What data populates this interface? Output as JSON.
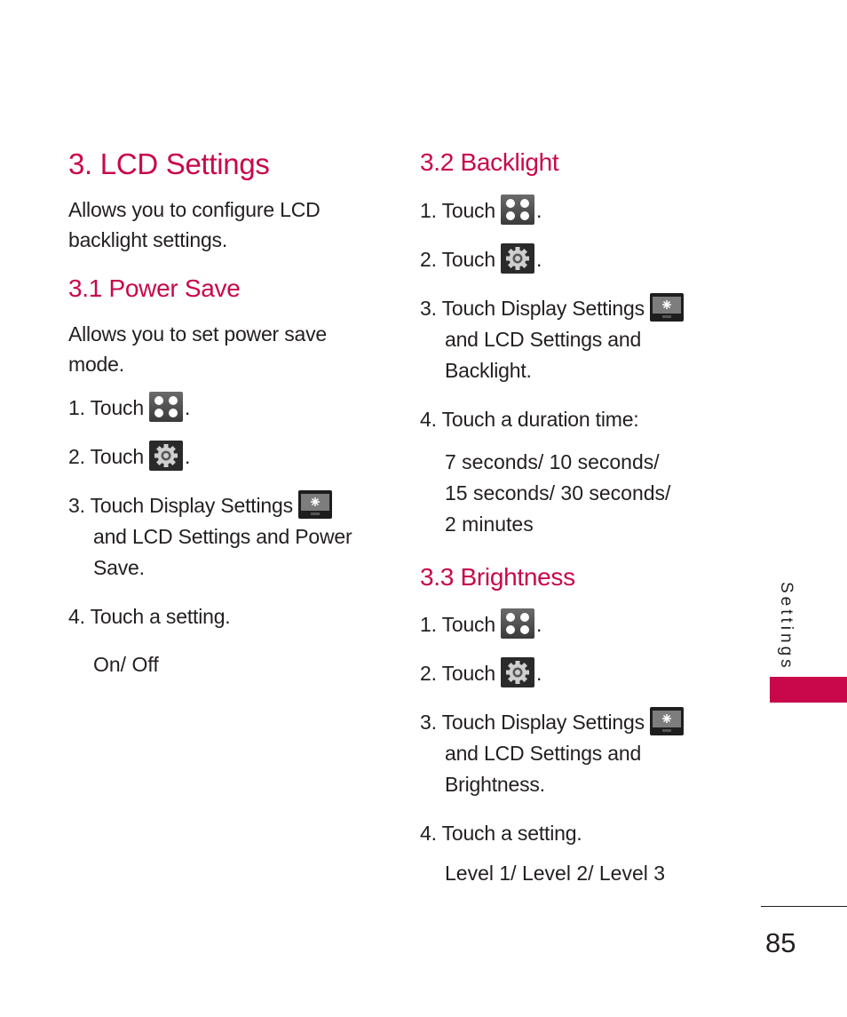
{
  "page": {
    "number": "85",
    "side_tab_label": "Settings",
    "accent_color": "#c8084a"
  },
  "left": {
    "title": "3. LCD Settings",
    "intro_line1": "Allows you to configure LCD",
    "intro_line2": "backlight settings.",
    "power_save": {
      "heading": "3.1 Power Save",
      "desc_line1": "Allows you to set power save",
      "desc_line2": "mode.",
      "step1": {
        "num": "1.",
        "text": "Touch",
        "icon": "menu-grid-icon",
        "end": "."
      },
      "step2": {
        "num": "2.",
        "text": "Touch",
        "icon": "settings-gear-icon",
        "end": "."
      },
      "step3": {
        "num": "3.",
        "text": "Touch",
        "bold1": "Display Settings",
        "icon": "display-settings-icon",
        "and1": "and",
        "bold2": "LCD Settings",
        "and2": "and",
        "bold3a": "Power",
        "bold3b": "Save",
        "end": "."
      },
      "step4": {
        "num": "4.",
        "text": "Touch a setting."
      },
      "options": "On/ Off"
    }
  },
  "right": {
    "backlight": {
      "heading": "3.2 Backlight",
      "step1": {
        "num": "1.",
        "text": "Touch",
        "end": "."
      },
      "step2": {
        "num": "2.",
        "text": "Touch",
        "end": "."
      },
      "step3": {
        "num": "3.",
        "text": "Touch",
        "bold1": "Display Settings",
        "and1": "and",
        "bold2": "LCD Settings",
        "and2": "and",
        "bold3": "Backlight",
        "end": "."
      },
      "step4": {
        "num": "4.",
        "text": "Touch a duration time:"
      },
      "options_line1": "7 seconds/ 10 seconds/",
      "options_line2": "15 seconds/ 30 seconds/",
      "options_line3": "2 minutes"
    },
    "brightness": {
      "heading": "3.3 Brightness",
      "step1": {
        "num": "1.",
        "text": "Touch",
        "end": "."
      },
      "step2": {
        "num": "2.",
        "text": "Touch",
        "end": "."
      },
      "step3": {
        "num": "3.",
        "text": "Touch",
        "bold1": "Display Settings",
        "and1": "and",
        "bold2": "LCD Settings",
        "and2": "and",
        "bold3": "Brightness",
        "end": "."
      },
      "step4": {
        "num": "4.",
        "text": "Touch a setting."
      },
      "options": "Level 1/ Level 2/ Level 3"
    }
  }
}
